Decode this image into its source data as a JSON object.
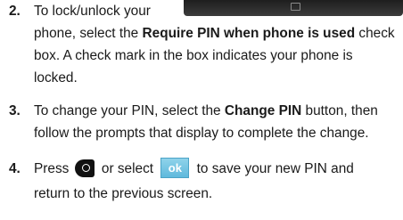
{
  "steps": [
    {
      "number": "2.",
      "lines": {
        "l1": "To lock/unlock your",
        "l2_pre": "phone, select the ",
        "l2_bold": "Require PIN when phone is used",
        "l2_post": " check",
        "l3": "box. A check mark in the box indicates your phone is",
        "l4": "locked."
      }
    },
    {
      "number": "3.",
      "lines": {
        "l1_pre": "To change your PIN, select the ",
        "l1_bold": "Change PIN",
        "l1_post": " button, then",
        "l2": "follow the prompts that display to complete the change."
      }
    },
    {
      "number": "4.",
      "lines": {
        "l1_pre": "Press ",
        "l1_mid": " or select ",
        "l1_post": " to save your new PIN and",
        "l2": "return to the previous screen."
      },
      "ok_label": "ok"
    }
  ],
  "icons": {
    "end_key": "end-key-icon",
    "ok_button": "ok-button-icon"
  }
}
